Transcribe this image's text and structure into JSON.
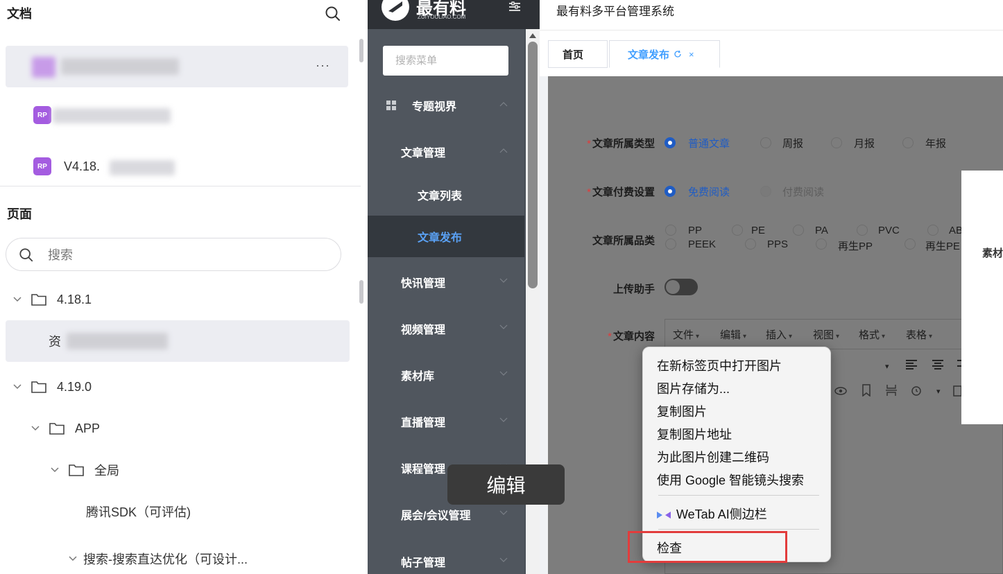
{
  "docs": {
    "title": "文档",
    "items": [
      {
        "label": "",
        "more": "···"
      },
      {
        "label": "",
        "icon_text": "RP"
      },
      {
        "label": "V4.18.",
        "icon_text": "RP"
      }
    ],
    "icon_color": "#a45ce0"
  },
  "pages": {
    "title": "页面",
    "search_placeholder": "搜索",
    "tree": [
      {
        "label": "4.18.1"
      },
      {
        "label": "资"
      },
      {
        "label": "4.19.0"
      },
      {
        "label": "APP"
      },
      {
        "label": "全局"
      },
      {
        "label": "腾讯SDK（可评估)"
      },
      {
        "label": "搜索-搜索直达优化（可设计..."
      }
    ]
  },
  "admin": {
    "logo": {
      "name": "最有料",
      "sub": "ZUIYOULIAO.COM"
    },
    "system_title": "最有料多平台管理系统",
    "menu_search_placeholder": "搜索菜单",
    "menu": [
      {
        "label": "专题视界"
      },
      {
        "label": "文章管理"
      },
      {
        "label": "文章列表"
      },
      {
        "label": "文章发布"
      },
      {
        "label": "快讯管理"
      },
      {
        "label": "视频管理"
      },
      {
        "label": "素材库"
      },
      {
        "label": "直播管理"
      },
      {
        "label": "课程管理"
      },
      {
        "label": "展会/会议管理"
      },
      {
        "label": "帖子管理"
      }
    ],
    "active_color": "#5aa1f4"
  },
  "tabs": [
    {
      "label": "首页"
    },
    {
      "label": "文章发布",
      "close": "×"
    }
  ],
  "form": {
    "type": {
      "label": "文章所属类型",
      "options": [
        "普通文章",
        "周报",
        "月报",
        "年报"
      ],
      "selected": "普通文章"
    },
    "fee": {
      "label": "文章付费设置",
      "options": [
        "免费阅读",
        "付费阅读"
      ],
      "selected": "免费阅读"
    },
    "category": {
      "label": "文章所属品类",
      "options_row1": [
        "PP",
        "PE",
        "PA",
        "PVC",
        "AB"
      ],
      "options_row2": [
        "PEEK",
        "PPS",
        "再生PP",
        "再生PE"
      ]
    },
    "helper": {
      "label": "上传助手"
    },
    "content": {
      "label": "文章内容",
      "toolbar": [
        "文件",
        "编辑",
        "插入",
        "视图",
        "格式",
        "表格"
      ]
    }
  },
  "dialog": {
    "text": "素材"
  },
  "context_menu": {
    "items": [
      "在新标签页中打开图片",
      "图片存储为...",
      "复制图片",
      "复制图片地址",
      "为此图片创建二维码",
      "使用 Google 智能镜头搜索"
    ],
    "wetab": "WeTab AI侧边栏",
    "inspect": "检查",
    "highlight_color": "#e23c3c"
  },
  "tooltip": {
    "text": "编辑"
  }
}
